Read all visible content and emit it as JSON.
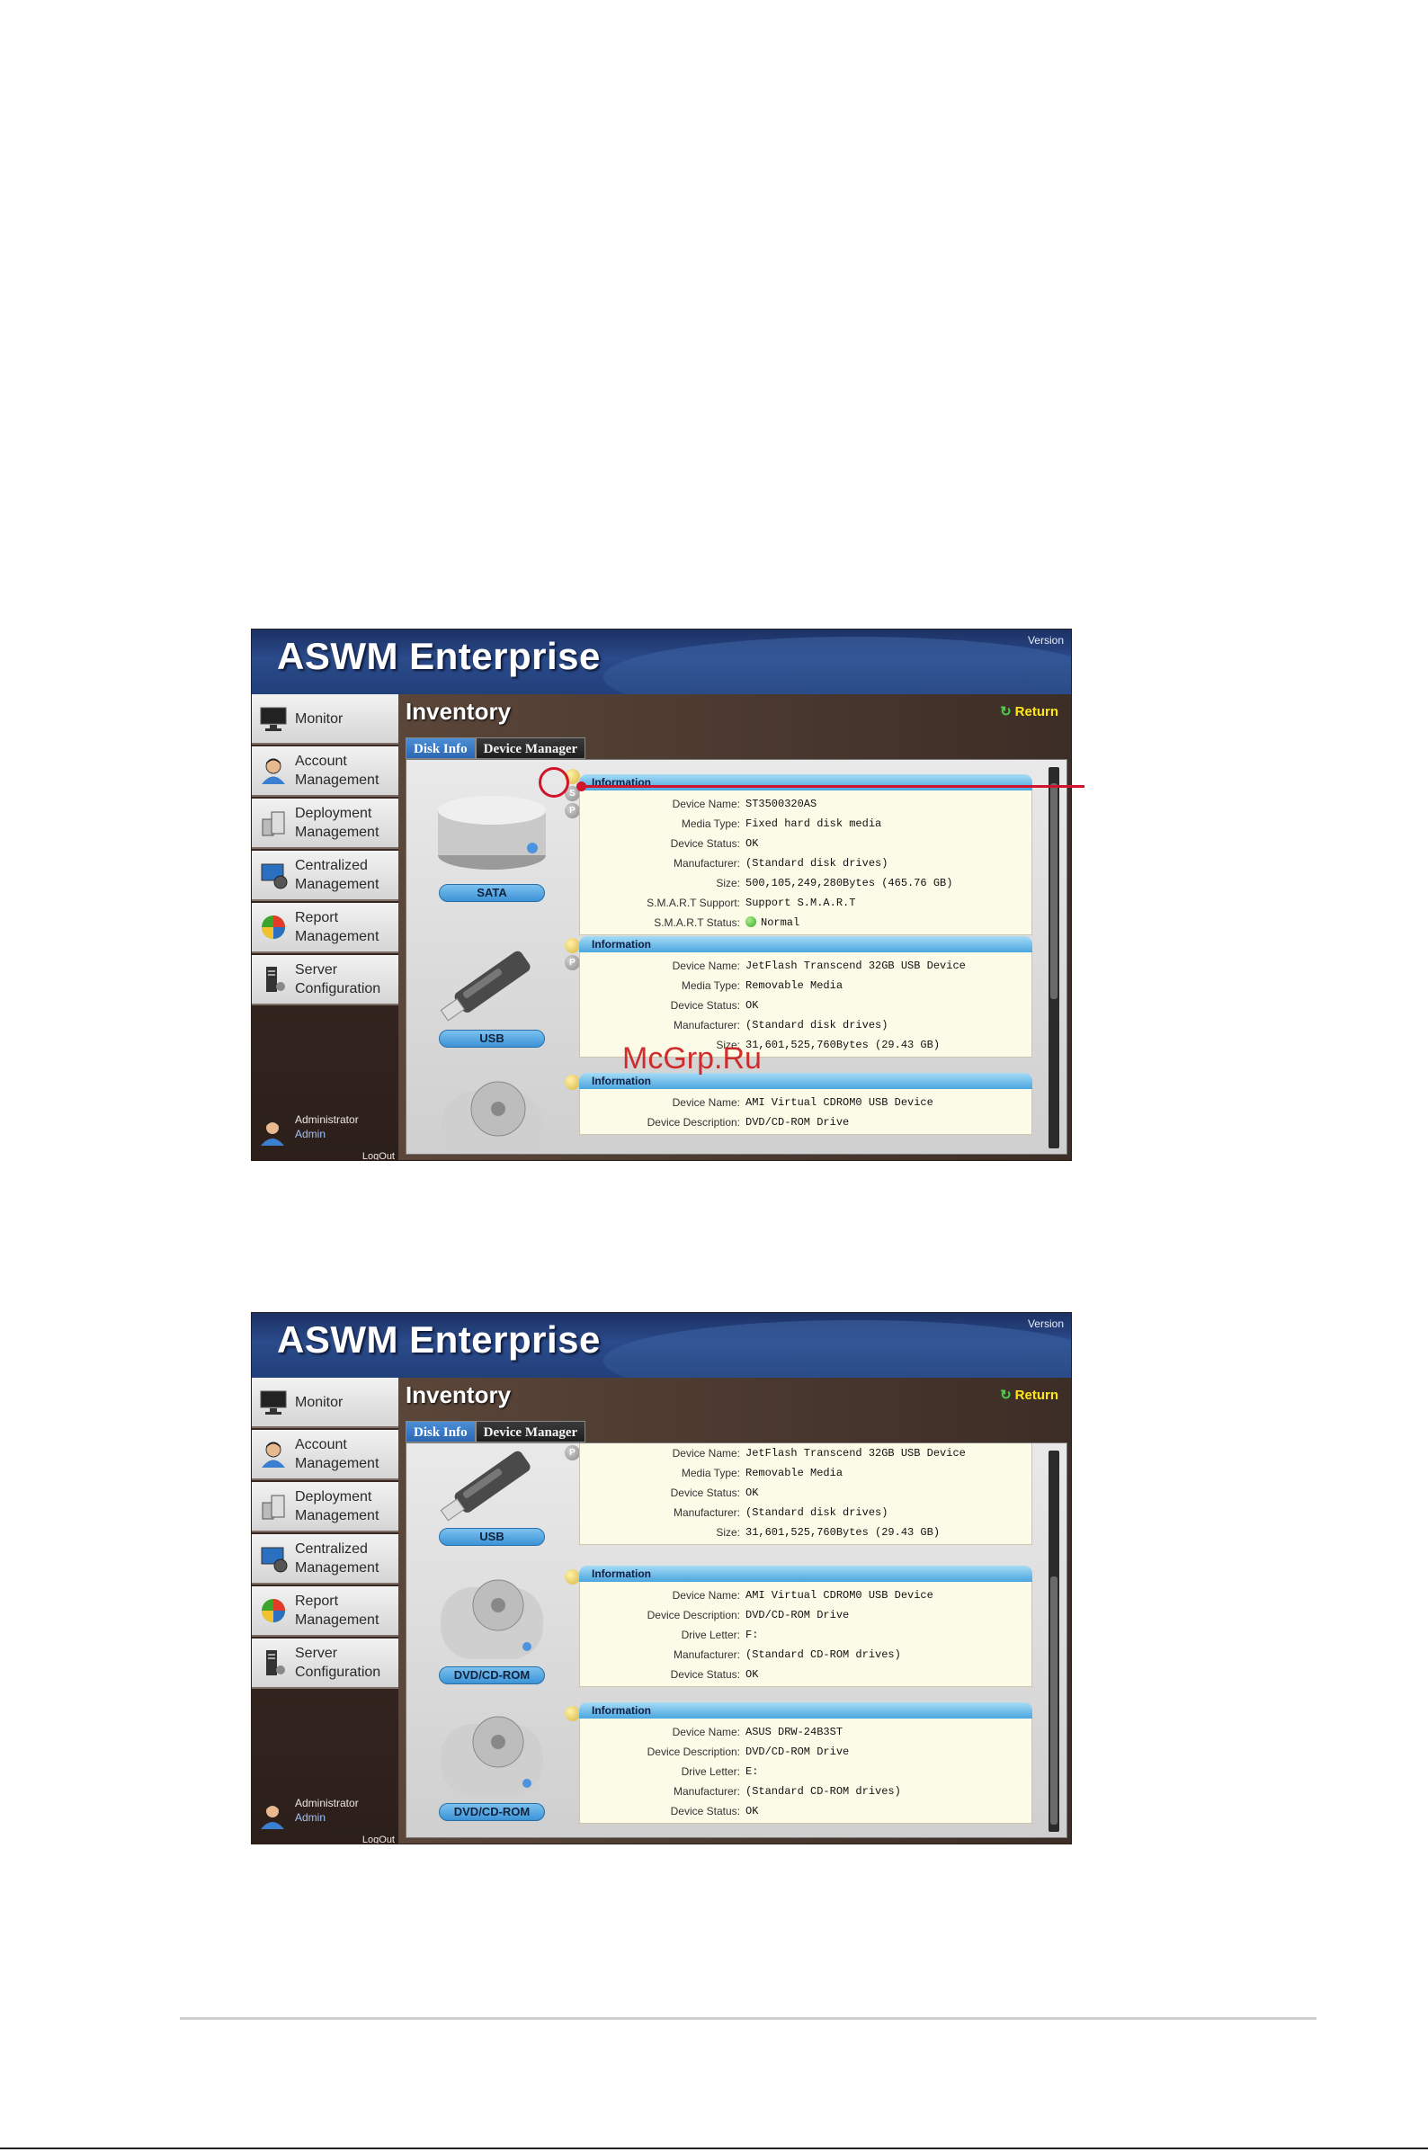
{
  "app": {
    "title": "ASWM Enterprise",
    "version_label": "Version"
  },
  "sidebar": {
    "items": [
      {
        "label": "Monitor",
        "icon": "monitor-icon"
      },
      {
        "label": "Account\nManagement",
        "icon": "account-user-icon"
      },
      {
        "label": "Deployment\nManagement",
        "icon": "deployment-icon"
      },
      {
        "label": "Centralized\nManagement",
        "icon": "centralized-icon"
      },
      {
        "label": "Report\nManagement",
        "icon": "report-pie-icon"
      },
      {
        "label": "Server\nConfiguration",
        "icon": "server-tower-icon"
      }
    ],
    "user": {
      "name": "Administrator",
      "role": "Admin"
    },
    "logout_label": "LogOut"
  },
  "page": {
    "title": "Inventory",
    "return_label": "Return"
  },
  "tabs": [
    {
      "label": "Disk Info",
      "active": true
    },
    {
      "label": "Device Manager",
      "active": false
    }
  ],
  "screenshot1": {
    "devices": [
      {
        "badge": "SATA",
        "header": "Information",
        "minis": [
          "",
          "S",
          "P"
        ],
        "rows": [
          {
            "key": "Device Name:",
            "value": "ST3500320AS"
          },
          {
            "key": "Media Type:",
            "value": "Fixed hard disk media"
          },
          {
            "key": "Device Status:",
            "value": "OK"
          },
          {
            "key": "Manufacturer:",
            "value": "(Standard disk drives)"
          },
          {
            "key": "Size:",
            "value": "500,105,249,280Bytes (465.76 GB)"
          },
          {
            "key": "S.M.A.R.T Support:",
            "value": "Support S.M.A.R.T"
          },
          {
            "key": "S.M.A.R.T Status:",
            "value": "Normal",
            "status": "ok"
          }
        ]
      },
      {
        "badge": "USB",
        "header": "Information",
        "minis": [
          "",
          "P"
        ],
        "rows": [
          {
            "key": "Device Name:",
            "value": "JetFlash Transcend 32GB USB Device"
          },
          {
            "key": "Media Type:",
            "value": "Removable Media"
          },
          {
            "key": "Device Status:",
            "value": "OK"
          },
          {
            "key": "Manufacturer:",
            "value": "(Standard disk drives)"
          },
          {
            "key": "Size:",
            "value": "31,601,525,760Bytes (29.43 GB)"
          }
        ]
      },
      {
        "badge": "",
        "header": "Information",
        "minis": [
          ""
        ],
        "rows": [
          {
            "key": "Device Name:",
            "value": "AMI Virtual CDROM0 USB Device"
          },
          {
            "key": "Device Description:",
            "value": "DVD/CD-ROM Drive"
          }
        ]
      }
    ]
  },
  "screenshot2": {
    "devices": [
      {
        "badge": "USB",
        "header": "",
        "minis": [
          "P"
        ],
        "rows": [
          {
            "key": "Device Name:",
            "value": "JetFlash Transcend 32GB USB Device"
          },
          {
            "key": "Media Type:",
            "value": "Removable Media"
          },
          {
            "key": "Device Status:",
            "value": "OK"
          },
          {
            "key": "Manufacturer:",
            "value": "(Standard disk drives)"
          },
          {
            "key": "Size:",
            "value": "31,601,525,760Bytes (29.43 GB)"
          }
        ]
      },
      {
        "badge": "DVD/CD-ROM",
        "header": "Information",
        "minis": [
          ""
        ],
        "rows": [
          {
            "key": "Device Name:",
            "value": "AMI Virtual CDROM0 USB Device"
          },
          {
            "key": "Device Description:",
            "value": "DVD/CD-ROM Drive"
          },
          {
            "key": "Drive Letter:",
            "value": "F:"
          },
          {
            "key": "Manufacturer:",
            "value": "(Standard CD-ROM drives)"
          },
          {
            "key": "Device Status:",
            "value": "OK"
          }
        ]
      },
      {
        "badge": "DVD/CD-ROM",
        "header": "Information",
        "minis": [
          ""
        ],
        "rows": [
          {
            "key": "Device Name:",
            "value": "ASUS DRW-24B3ST"
          },
          {
            "key": "Device Description:",
            "value": "DVD/CD-ROM Drive"
          },
          {
            "key": "Drive Letter:",
            "value": "E:"
          },
          {
            "key": "Manufacturer:",
            "value": "(Standard CD-ROM drives)"
          },
          {
            "key": "Device Status:",
            "value": "OK"
          }
        ]
      }
    ]
  },
  "watermark": "McGrp.Ru",
  "colors": {
    "callout": "#d0142c",
    "accent": "#2b66b3",
    "return": "#ffe61a"
  }
}
